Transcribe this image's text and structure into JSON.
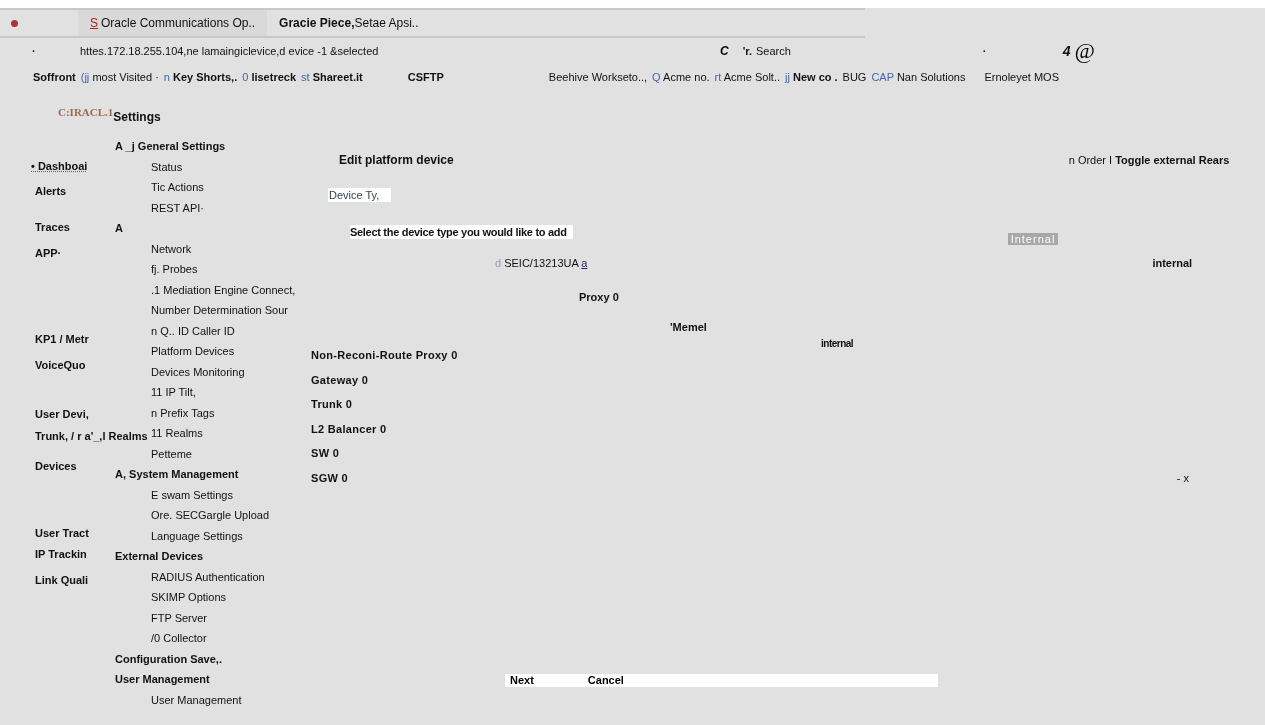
{
  "tabs": [
    {
      "icon": "S",
      "title": "Oracle Communications Op..",
      "selected": true
    },
    {
      "title": "Gracie Piece,",
      "subtitle": "Setae Apsi..",
      "selected": false
    }
  ],
  "address_bar": {
    "dot": "·",
    "url": "httes.172.18.255.104,ne lamaingiclevice,d evice -1 &selected",
    "reload": "C",
    "search_prefix": "'r.",
    "search_placeholder": "Search",
    "menu_dot": "·",
    "badge": "4",
    "account": "@"
  },
  "bookmarks": [
    {
      "label": "Soffront",
      "bold": true
    },
    {
      "prefix": "(jj",
      "label": "most Visited · ",
      "bold": false
    },
    {
      "prefix": "n",
      "label": "Key Shorts,.",
      "bold": true
    },
    {
      "prefix": "0",
      "label": "lisetreck",
      "bold": true
    },
    {
      "prefix": "st",
      "label": "Shareet.it",
      "bold": true
    },
    {
      "label": "CSFTP",
      "bold": true
    },
    {
      "label": "Beehive Workseto..,",
      "bold": false
    },
    {
      "prefix": "Q",
      "label": "Acme no.",
      "bold": false
    },
    {
      "prefix": "rt",
      "label": "Acme Solt..",
      "bold": false
    },
    {
      "prefix": "jj",
      "label": "New co .",
      "bold": true
    },
    {
      "label": "BUG",
      "bold": false
    },
    {
      "prefix": "CAP",
      "label": "Nan Solutions",
      "bold": false
    },
    {
      "label": "Ernoleyet MOS",
      "bold": false
    }
  ],
  "header": {
    "logo": "C:IRACL.1",
    "title": "Settings"
  },
  "sidebar": {
    "items": [
      {
        "marker": "•",
        "label": "Dashboai",
        "selected": true
      },
      {
        "label": "Alerts",
        "selected": false
      },
      {
        "label": "Traces",
        "selected": false
      },
      {
        "label": "APP·",
        "selected": false
      },
      {
        "label": "KP1 / Metr",
        "selected": false
      },
      {
        "label": "VoiceQuo",
        "selected": false
      },
      {
        "label": "User Devi,",
        "selected": false
      },
      {
        "label": "Trunk, / r a'_,l Realms",
        "selected": false
      },
      {
        "label": "Devices",
        "selected": false
      },
      {
        "label": "User Tract",
        "selected": false
      },
      {
        "label": "IP Trackin",
        "selected": false
      },
      {
        "label": "Link Quali",
        "selected": false
      }
    ]
  },
  "settings_nav": [
    {
      "label": "A _j General Settings",
      "children": [
        {
          "label": "Status"
        },
        {
          "label": "Tic Actions"
        },
        {
          "label": "REST API·"
        }
      ]
    },
    {
      "label": "A",
      "children": [
        {
          "label": "Network"
        },
        {
          "label": "fj. Probes"
        },
        {
          "label": ".1 Mediation Engine Connect,"
        },
        {
          "label": "Number Determination Sour"
        },
        {
          "label": "n Q.. ID Caller ID"
        },
        {
          "label": "Platform Devices"
        },
        {
          "label": "Devices Monitoring"
        },
        {
          "label": "11 IP Tilt,"
        },
        {
          "label": "n Prefix Tags"
        },
        {
          "label": "11 Realms"
        },
        {
          "label": "Petteme"
        }
      ]
    },
    {
      "label": "A, System Management",
      "children": [
        {
          "label": "E swam Settings"
        },
        {
          "label": "Ore. SECGargle Upload"
        },
        {
          "label": "Language Settings"
        }
      ]
    },
    {
      "label": "External Devices",
      "children": [
        {
          "label": "RADIUS Authentication"
        },
        {
          "label": "SKIMP Options"
        },
        {
          "label": "FTP Server"
        },
        {
          "label": "/0 Collector"
        }
      ]
    },
    {
      "label": "Configuration Save,."
    },
    {
      "label": "User Management",
      "children": [
        {
          "label": "User Management"
        }
      ]
    }
  ],
  "content": {
    "title": "Edit platform device",
    "order_text": "n Order I",
    "toggle": "Toggle external Rears",
    "field_label": "Device Ty,",
    "prompt": "Select the device type you would like to add",
    "internal_header": "Internal",
    "selected_device": {
      "icon": "d",
      "name": "SEIC/13213UA",
      "link": "a"
    },
    "internal_right": "internal",
    "proxy": "Proxy 0",
    "memel": "'Memel",
    "internal_mid": "internal",
    "device_types": [
      "Non-Reconi-Route Proxy 0",
      "Gateway 0",
      "Trunk 0",
      "L2 Balancer 0",
      "SW 0",
      "SGW 0"
    ],
    "close": "- x"
  },
  "buttons": [
    "Next",
    "Cancel"
  ]
}
